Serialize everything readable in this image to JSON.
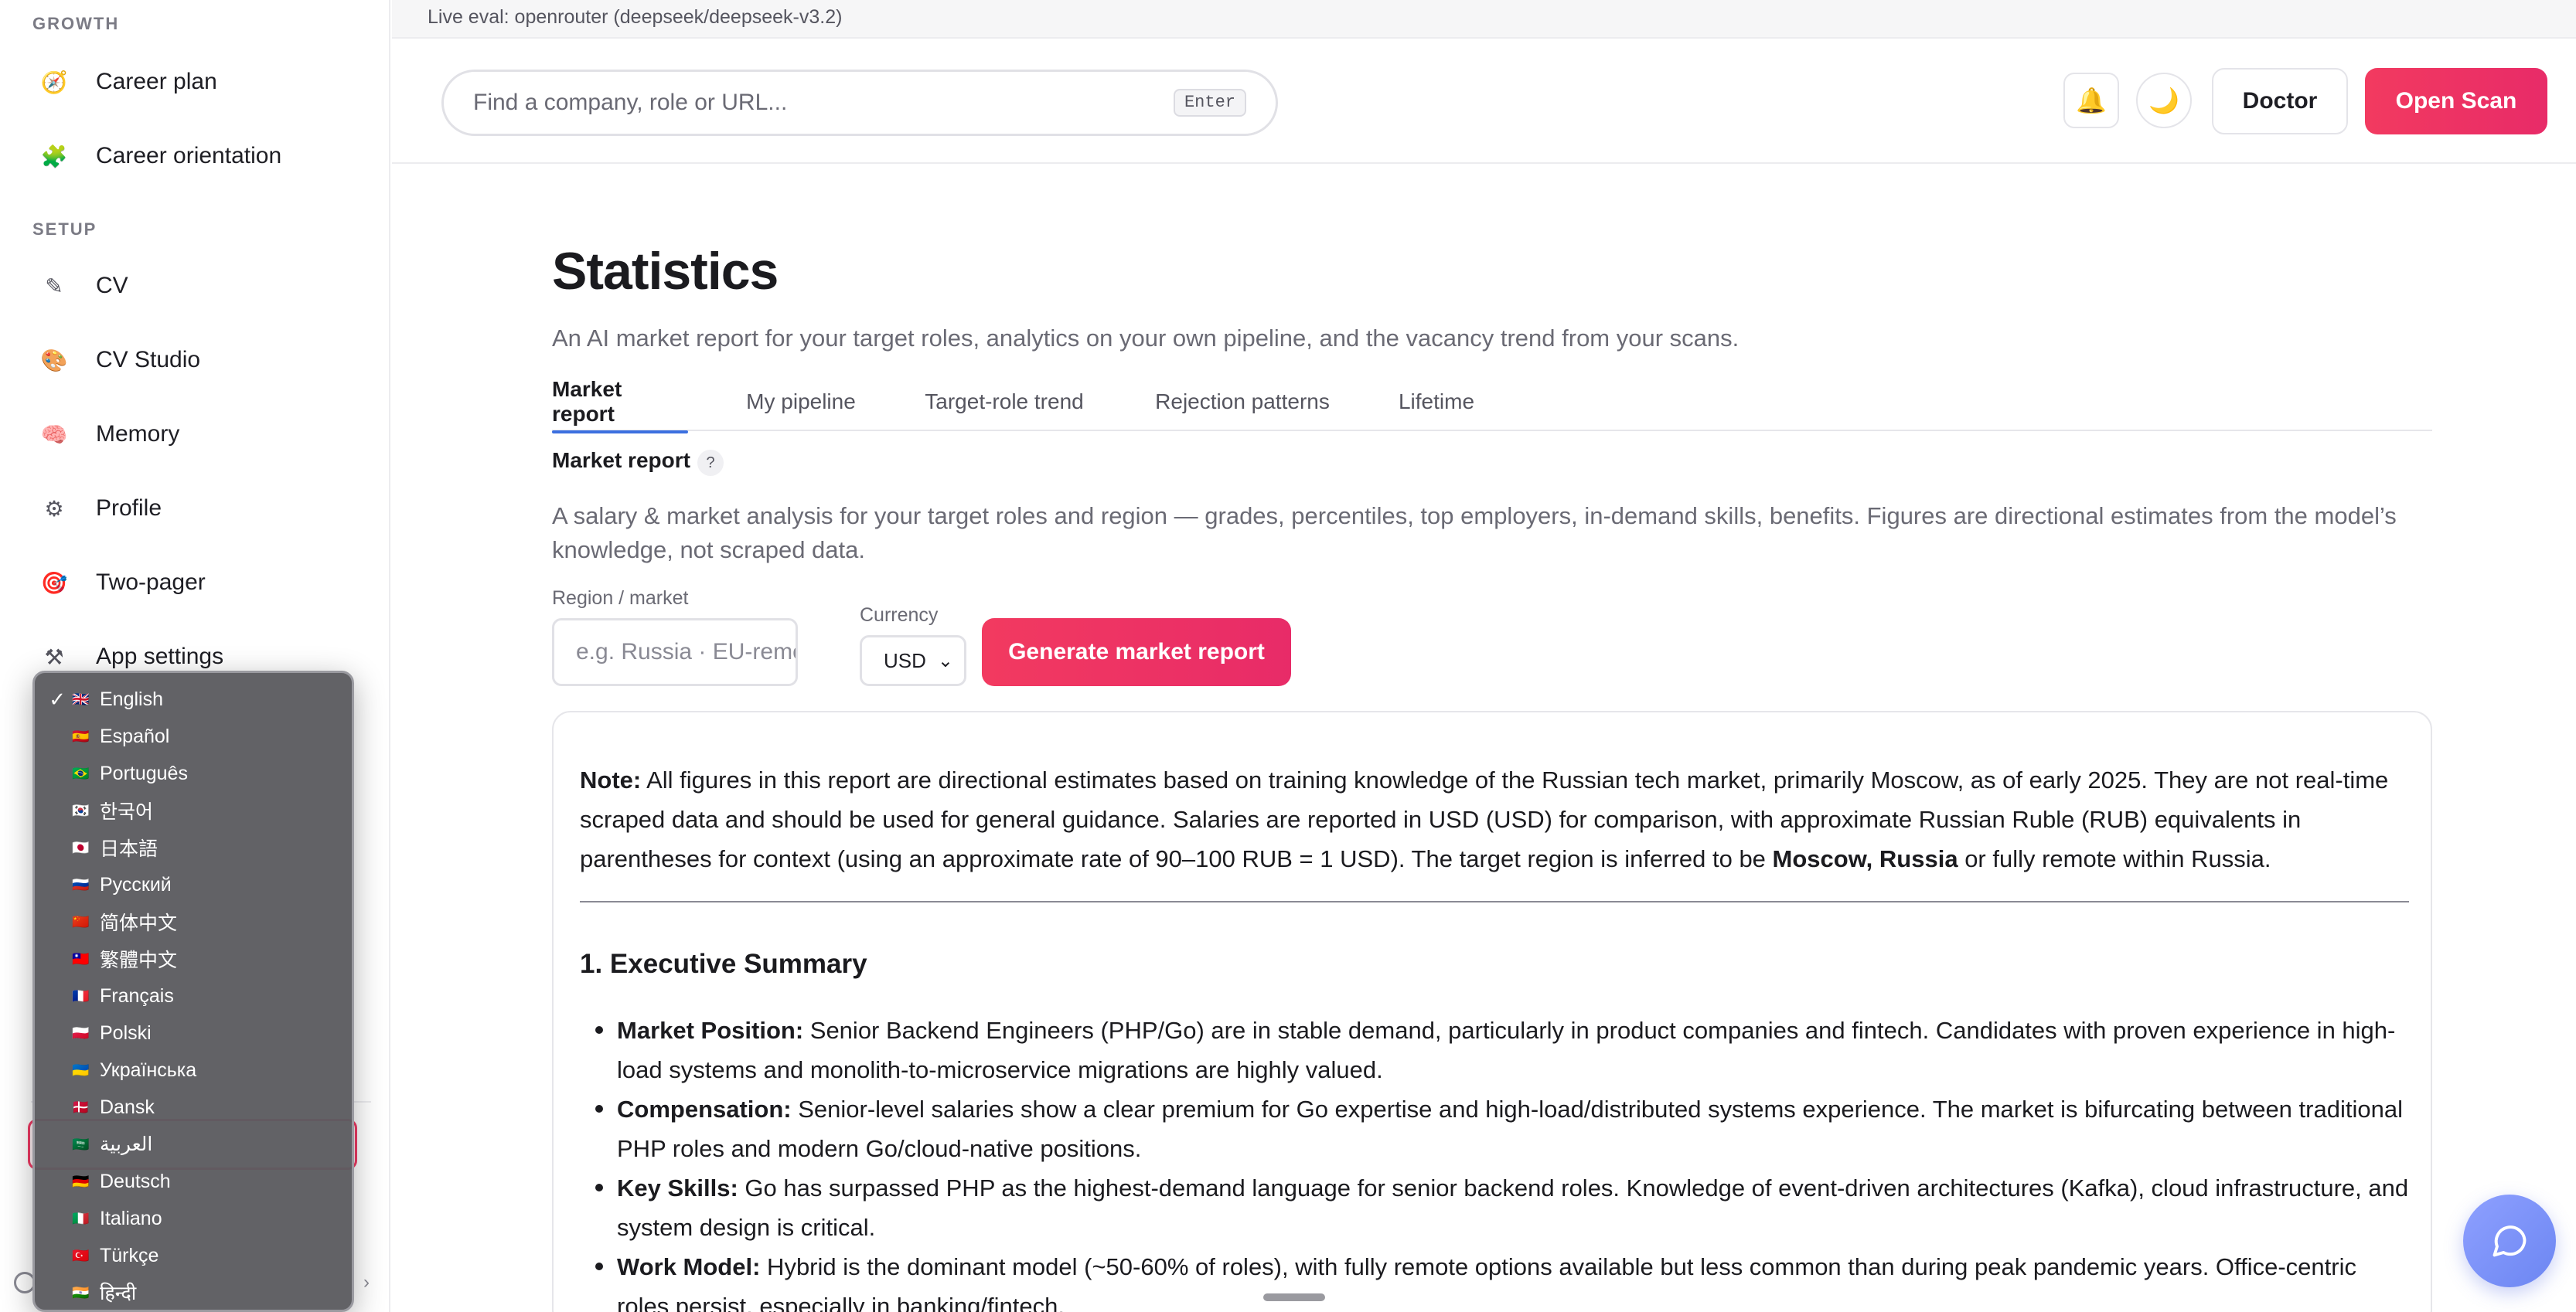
{
  "sidebar": {
    "sections": {
      "growth": "GROWTH",
      "setup": "SETUP"
    },
    "items": [
      {
        "label": "Career plan",
        "icon": "🧭"
      },
      {
        "label": "Career orientation",
        "icon": "🧩"
      },
      {
        "label": "CV",
        "icon": "✎"
      },
      {
        "label": "CV Studio",
        "icon": "🎨"
      },
      {
        "label": "Memory",
        "icon": "🧠"
      },
      {
        "label": "Profile",
        "icon": "⚙"
      },
      {
        "label": "Two-pager",
        "icon": "🎯"
      },
      {
        "label": "App settings",
        "icon": "⚒"
      }
    ]
  },
  "language_menu": {
    "check": "✓",
    "items": [
      {
        "flag": "🇬🇧",
        "label": "English",
        "selected": true
      },
      {
        "flag": "🇪🇸",
        "label": "Español"
      },
      {
        "flag": "🇧🇷",
        "label": "Português"
      },
      {
        "flag": "🇰🇷",
        "label": "한국어"
      },
      {
        "flag": "🇯🇵",
        "label": "日本語"
      },
      {
        "flag": "🇷🇺",
        "label": "Русский"
      },
      {
        "flag": "🇨🇳",
        "label": "简体中文"
      },
      {
        "flag": "🇹🇼",
        "label": "繁體中文"
      },
      {
        "flag": "🇫🇷",
        "label": "Français"
      },
      {
        "flag": "🇵🇱",
        "label": "Polski"
      },
      {
        "flag": "🇺🇦",
        "label": "Українська"
      },
      {
        "flag": "🇩🇰",
        "label": "Dansk"
      },
      {
        "flag": "🇸🇦",
        "label": "العربية"
      },
      {
        "flag": "🇩🇪",
        "label": "Deutsch"
      },
      {
        "flag": "🇮🇹",
        "label": "Italiano"
      },
      {
        "flag": "🇹🇷",
        "label": "Türkçe"
      },
      {
        "flag": "🇮🇳",
        "label": "हिन्दी"
      }
    ]
  },
  "topbar": {
    "live_eval": "Live eval: openrouter (deepseek/deepseek-v3.2)"
  },
  "header": {
    "search_placeholder": "Find a company, role or URL...",
    "enter_hint": "Enter",
    "bell_icon": "🔔",
    "moon_icon": "🌙",
    "doctor_label": "Doctor",
    "scan_label": "Open Scan"
  },
  "page": {
    "title": "Statistics",
    "subtitle": "An AI market report for your target roles, analytics on your own pipeline, and the vacancy trend from your scans.",
    "tabs": [
      "Market report",
      "My pipeline",
      "Target-role trend",
      "Rejection patterns",
      "Lifetime"
    ],
    "active_tab": 0
  },
  "market": {
    "label": "Market report",
    "help": "?",
    "description": "A salary & market analysis for your target roles and region — grades, percentiles, top employers, in-demand skills, benefits. Figures are directional estimates from the model’s knowledge, not scraped data.",
    "region_label": "Region / market",
    "region_placeholder": "e.g. Russia · EU-remote",
    "currency_label": "Currency",
    "currency_value": "USD",
    "generate_label": "Generate market report"
  },
  "report": {
    "note_label": "Note:",
    "note_text_1": " All figures in this report are directional estimates based on training knowledge of the Russian tech market, primarily Moscow, as of early 2025. They are not real-time scraped data and should be used for general guidance. Salaries are reported in USD (USD) for comparison, with approximate Russian Ruble (RUB) equivalents in parentheses for context (using an approximate rate of 90–100 RUB = 1 USD). The target region is inferred to be ",
    "note_bold": "Moscow, Russia",
    "note_text_2": " or fully remote within Russia.",
    "heading": "1. Executive Summary",
    "bullets": [
      {
        "term": "Market Position:",
        "text": " Senior Backend Engineers (PHP/Go) are in stable demand, particularly in product companies and fintech. Candidates with proven experience in high-load systems and monolith-to-microservice migrations are highly valued."
      },
      {
        "term": "Compensation:",
        "text": " Senior-level salaries show a clear premium for Go expertise and high-load/distributed systems experience. The market is bifurcating between traditional PHP roles and modern Go/cloud-native positions."
      },
      {
        "term": "Key Skills:",
        "text": " Go has surpassed PHP as the highest-demand language for senior backend roles. Knowledge of event-driven architectures (Kafka), cloud infrastructure, and system design is critical."
      },
      {
        "term": "Work Model:",
        "text": " Hybrid is the dominant model (~50-60% of roles), with fully remote options available but less common than during peak pandemic years. Office-centric roles persist, especially in banking/fintech."
      }
    ]
  }
}
